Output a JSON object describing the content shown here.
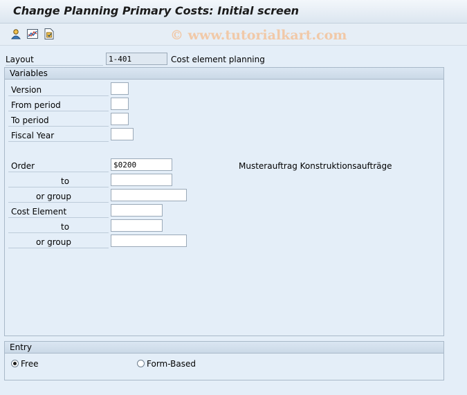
{
  "title": "Change Planning Primary Costs: Initial screen",
  "watermark": "© www.tutorialkart.com",
  "toolbar": {
    "icons": [
      "person-icon",
      "chart-icon",
      "document-icon"
    ]
  },
  "layout": {
    "label": "Layout",
    "value": "1-401",
    "description": "Cost element planning"
  },
  "variables": {
    "title": "Variables",
    "version_label": "Version",
    "from_period_label": "From period",
    "to_period_label": "To period",
    "fiscal_year_label": "Fiscal Year",
    "order_label": "Order",
    "order_value": "$0200",
    "order_description": "Musterauftrag Konstruktionsaufträge",
    "order_to_label": "to",
    "order_group_label": "or group",
    "cost_element_label": "Cost Element",
    "cost_element_to_label": "to",
    "cost_element_group_label": "or group"
  },
  "entry": {
    "title": "Entry",
    "free_label": "Free",
    "form_based_label": "Form-Based",
    "selected": "Free"
  }
}
